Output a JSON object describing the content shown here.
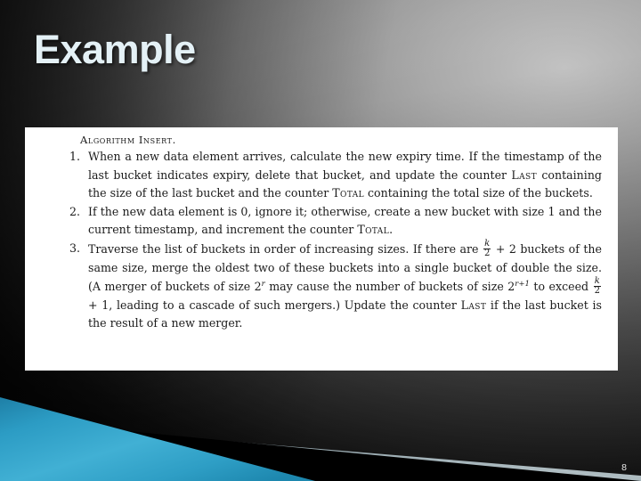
{
  "slide": {
    "title": "Example",
    "number": "8",
    "colors": {
      "title_text": "#e4f1f6",
      "panel_background": "#ffffff",
      "accent_blue": "#2fa2cc",
      "accent_black": "#000000",
      "accent_grey": "#9fb0b6",
      "background_dark": "#0d0d0d",
      "background_light": "#b9b9b9"
    }
  },
  "algorithm": {
    "heading": "Algorithm Insert.",
    "steps": [
      {
        "number": "1.",
        "parts": [
          {
            "type": "text",
            "value": "When a new data element arrives, calculate the new expiry time. If the timestamp of the last bucket indicates expiry, delete that bucket, and update the counter "
          },
          {
            "type": "smallcaps",
            "value": "Last"
          },
          {
            "type": "text",
            "value": " containing the size of the last bucket and the counter "
          },
          {
            "type": "smallcaps",
            "value": "Total"
          },
          {
            "type": "text",
            "value": " containing the total size of the buckets."
          }
        ],
        "plain": "When a new data element arrives, calculate the new expiry time. If the timestamp of the last bucket indicates expiry, delete that bucket, and update the counter LAST containing the size of the last bucket and the counter TOTAL containing the total size of the buckets."
      },
      {
        "number": "2.",
        "parts": [
          {
            "type": "text",
            "value": "If the new data element is 0, ignore it; otherwise, create a new bucket with size 1 and the current timestamp, and increment the counter "
          },
          {
            "type": "smallcaps",
            "value": "Total"
          },
          {
            "type": "text",
            "value": "."
          }
        ],
        "plain": "If the new data element is 0, ignore it; otherwise, create a new bucket with size 1 and the current timestamp, and increment the counter TOTAL."
      },
      {
        "number": "3.",
        "parts": [
          {
            "type": "text",
            "value": "Traverse the list of buckets in order of increasing sizes. If there are "
          },
          {
            "type": "fraction",
            "numerator": "k",
            "denominator": "2"
          },
          {
            "type": "text",
            "value": " + 2 buckets of the same size, merge the oldest two of these buckets into a single bucket of double the size. (A merger of buckets of size 2"
          },
          {
            "type": "superscript",
            "value": "r"
          },
          {
            "type": "text",
            "value": " may cause the number of buckets of size 2"
          },
          {
            "type": "superscript",
            "value": "r+1"
          },
          {
            "type": "text",
            "value": " to exceed "
          },
          {
            "type": "fraction",
            "numerator": "k",
            "denominator": "2"
          },
          {
            "type": "text",
            "value": " + 1, leading to a cascade of such mergers.) Update the counter "
          },
          {
            "type": "smallcaps",
            "value": "Last"
          },
          {
            "type": "text",
            "value": " if the last bucket is the result of a new merger."
          }
        ],
        "plain": "Traverse the list of buckets in order of increasing sizes. If there are k/2 + 2 buckets of the same size, merge the oldest two of these buckets into a single bucket of double the size. (A merger of buckets of size 2^r may cause the number of buckets of size 2^(r+1) to exceed k/2 + 1, leading to a cascade of such mergers.) Update the counter LAST if the last bucket is the result of a new merger."
      }
    ]
  }
}
